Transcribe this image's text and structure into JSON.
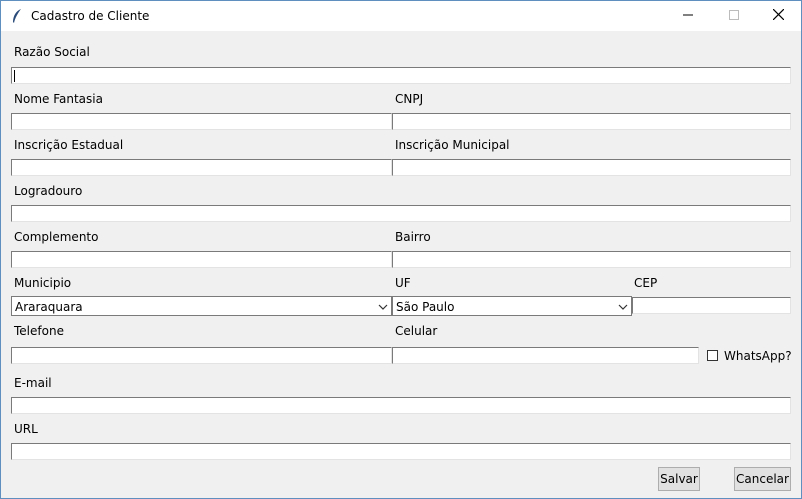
{
  "window": {
    "title": "Cadastro de Cliente",
    "controls": [
      "minimize-icon",
      "maximize-icon",
      "close-icon"
    ]
  },
  "form": {
    "razao_social_label": "Razão Social",
    "nome_fantasia_label": "Nome Fantasia",
    "cnpj_label": "CNPJ",
    "inscricao_estadual_label": "Inscrição Estadual",
    "inscricao_municipal_label": "Inscrição Municipal",
    "logradouro_label": "Logradouro",
    "complemento_label": "Complemento",
    "bairro_label": "Bairro",
    "municipio_label": "Municipio",
    "municipio_value": "Araraquara",
    "uf_label": "UF",
    "uf_value": "São Paulo",
    "cep_label": "CEP",
    "telefone_label": "Telefone",
    "celular_label": "Celular",
    "whatsapp_label": "WhatsApp?",
    "whatsapp_checked": false,
    "email_label": "E-mail",
    "url_label": "URL"
  },
  "buttons": {
    "salvar": "Salvar",
    "cancelar": "Cancelar"
  }
}
